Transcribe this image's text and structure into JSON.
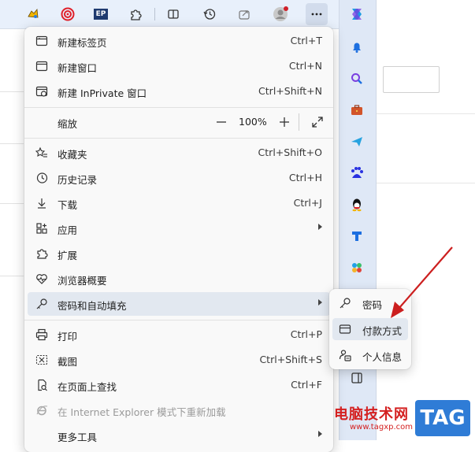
{
  "toolbar": {
    "icons": [
      "extension-icon-1",
      "target-icon",
      "ep-icon",
      "extensions-icon",
      "split-screen-icon",
      "history-icon",
      "share-icon",
      "profile-icon",
      "more-icon",
      "copilot-icon"
    ],
    "ep_label": "EP"
  },
  "menu": {
    "items": [
      {
        "label": "新建标签页",
        "shortcut": "Ctrl+T"
      },
      {
        "label": "新建窗口",
        "shortcut": "Ctrl+N"
      },
      {
        "label": "新建 InPrivate 窗口",
        "shortcut": "Ctrl+Shift+N"
      },
      {
        "label": "缩放",
        "zoom_value": "100%"
      },
      {
        "label": "收藏夹",
        "shortcut": "Ctrl+Shift+O"
      },
      {
        "label": "历史记录",
        "shortcut": "Ctrl+H"
      },
      {
        "label": "下载",
        "shortcut": "Ctrl+J"
      },
      {
        "label": "应用"
      },
      {
        "label": "扩展"
      },
      {
        "label": "浏览器概要"
      },
      {
        "label": "密码和自动填充"
      },
      {
        "label": "打印",
        "shortcut": "Ctrl+P"
      },
      {
        "label": "截图",
        "shortcut": "Ctrl+Shift+S"
      },
      {
        "label": "在页面上查找",
        "shortcut": "Ctrl+F"
      },
      {
        "label": "在 Internet Explorer 模式下重新加载"
      },
      {
        "label": "更多工具"
      }
    ]
  },
  "submenu": {
    "items": [
      {
        "label": "密码"
      },
      {
        "label": "付款方式"
      },
      {
        "label": "个人信息"
      }
    ]
  },
  "sidebar": {
    "icons": [
      "notification-bell-icon",
      "search-icon",
      "briefcase-icon",
      "send-icon",
      "baidu-icon",
      "qq-icon",
      "app-icon",
      "clover-icon",
      "sidebar-toggle-icon"
    ]
  },
  "watermark": {
    "site_name": "电脑技术网",
    "url": "www.tagxp.com",
    "tag": "TAG"
  },
  "colors": {
    "toolbar_bg": "#e8f0fb",
    "sidebar_bg": "#dfe8f6",
    "menu_bg": "#f9f9f9",
    "active_item": "#e2e8f0",
    "annotation_red": "#cc1f1f"
  }
}
